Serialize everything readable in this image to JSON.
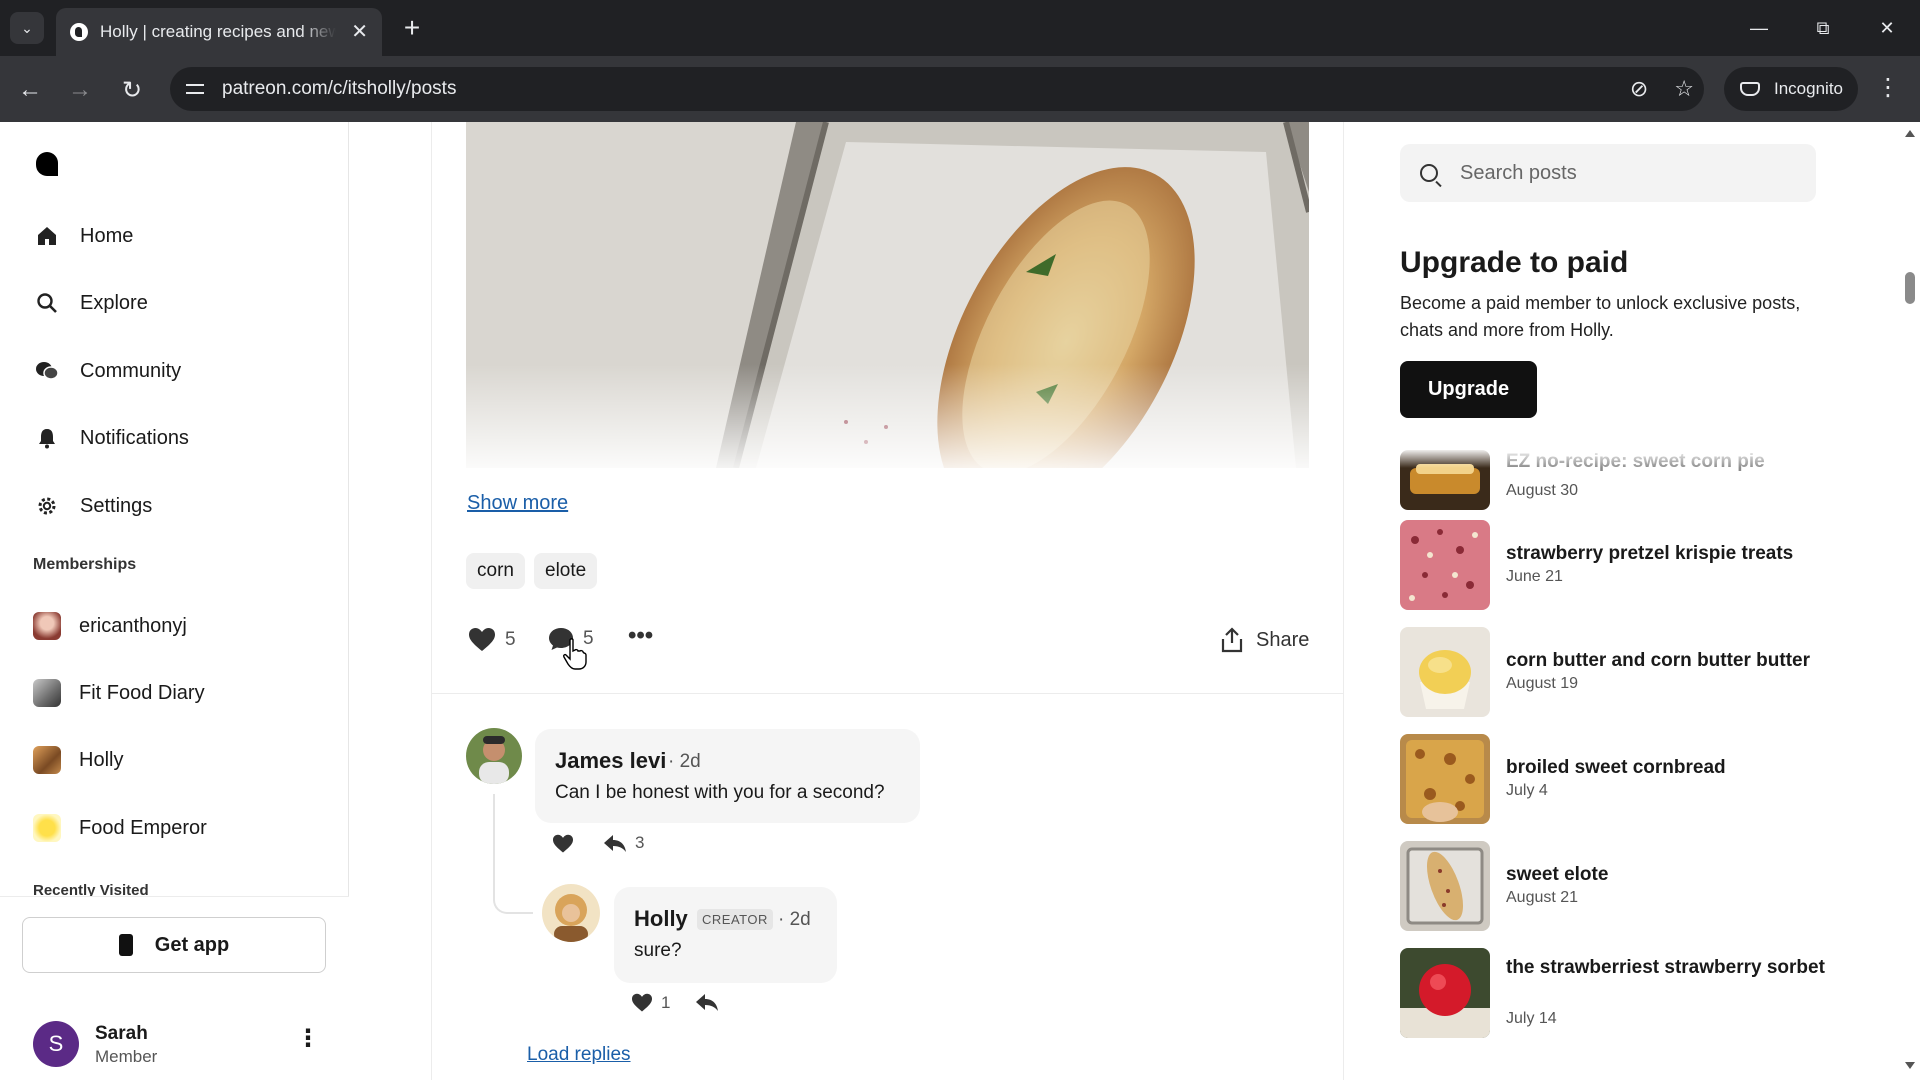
{
  "browser": {
    "tab_title": "Holly | creating recipes and new",
    "url": "patreon.com/c/itsholly/posts",
    "incognito_label": "Incognito"
  },
  "sidebar": {
    "nav": [
      {
        "label": "Home",
        "icon": "home-icon"
      },
      {
        "label": "Explore",
        "icon": "search-icon"
      },
      {
        "label": "Community",
        "icon": "chat-bubbles-icon"
      },
      {
        "label": "Notifications",
        "icon": "bell-icon"
      },
      {
        "label": "Settings",
        "icon": "gear-icon"
      }
    ],
    "memberships_label": "Memberships",
    "memberships": [
      {
        "label": "ericanthonyj"
      },
      {
        "label": "Fit Food Diary"
      },
      {
        "label": "Holly"
      },
      {
        "label": "Food Emperor"
      }
    ],
    "recently_visited_label": "Recently Visited",
    "get_app_label": "Get app",
    "user": {
      "initial": "S",
      "name": "Sarah",
      "role": "Member"
    }
  },
  "post": {
    "show_more_label": "Show more",
    "tags": [
      "corn",
      "elote"
    ],
    "like_count": "5",
    "comment_count": "5",
    "share_label": "Share"
  },
  "comments": [
    {
      "author": "James levi",
      "time": "2d",
      "text": "Can I be honest with you for a second?",
      "reply_count": "3"
    },
    {
      "author": "Holly",
      "badge": "CREATOR",
      "time": "2d",
      "text": "sure?",
      "like_count": "1"
    }
  ],
  "load_replies_label": "Load replies",
  "right": {
    "search_placeholder": "Search posts",
    "upgrade_title": "Upgrade to paid",
    "upgrade_desc": "Become a paid member to unlock exclusive posts, chats and more from Holly.",
    "upgrade_button": "Upgrade",
    "recent_posts": [
      {
        "title": "EZ no-recipe: sweet corn pie",
        "date": "August 30"
      },
      {
        "title": "strawberry pretzel krispie treats",
        "date": "June 21"
      },
      {
        "title": "corn butter and corn butter butter",
        "date": "August 19"
      },
      {
        "title": "broiled sweet cornbread",
        "date": "July 4"
      },
      {
        "title": "sweet elote",
        "date": "August 21"
      },
      {
        "title": "the strawberriest strawberry sorbet",
        "date": "July 14"
      }
    ]
  },
  "colors": {
    "link": "#1a5ea8",
    "accent_dark": "#111111",
    "avatar_purple": "#5b2a86"
  }
}
